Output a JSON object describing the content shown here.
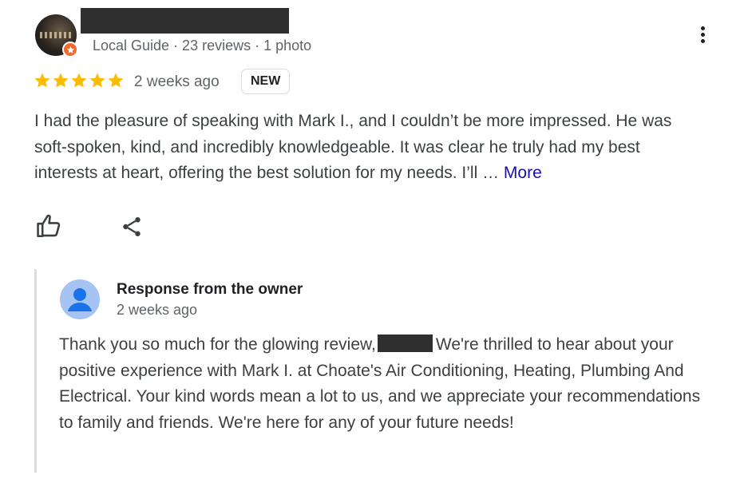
{
  "review": {
    "reviewer_meta": "Local Guide · 23 reviews · 1 photo",
    "rating": 5,
    "max_rating": 5,
    "time": "2 weeks ago",
    "badge": "NEW",
    "text": "I had the pleasure of speaking with Mark I., and I couldn’t be more impressed. He was soft-spoken, kind, and incredibly knowledgeable. It was clear he truly had my best interests at heart, offering the best solution for my needs. I’ll …",
    "more_label": "More"
  },
  "response": {
    "title": "Response from the owner",
    "time": "2 weeks ago",
    "text_before": "Thank you so much for the glowing review,",
    "text_after": "We're thrilled to hear about your positive experience with Mark I. at Choate's Air Conditioning, Heating, Plumbing And Electrical. Your kind words mean a lot to us, and we appreciate your recommendations to family and friends. We're here for any of your future needs!"
  },
  "icons": {
    "avatar": "user-photo-avatar",
    "guide": "local-guide-badge-icon",
    "menu": "more-vert-icon",
    "like": "thumb-up-icon",
    "share": "share-icon",
    "owner": "owner-avatar-icon"
  },
  "colors": {
    "star": "#fbbc04",
    "link": "#1a0dab",
    "guide_badge": "#f06a2f",
    "owner_avatar_bg": "#a5c4f3",
    "owner_avatar_fg": "#1a73e8"
  }
}
